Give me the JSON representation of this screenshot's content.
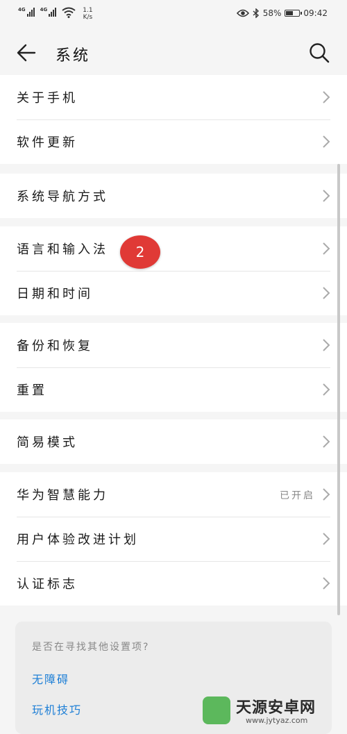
{
  "status_bar": {
    "network_1": "4G",
    "network_2": "4G",
    "speed_value": "1.1",
    "speed_unit": "K/s",
    "battery": "58%",
    "battery_level": 0.58,
    "time": "09:42"
  },
  "header": {
    "title": "系统"
  },
  "groups": [
    {
      "items": [
        {
          "label": "关于手机"
        },
        {
          "label": "软件更新"
        }
      ]
    },
    {
      "items": [
        {
          "label": "系统导航方式"
        }
      ]
    },
    {
      "items": [
        {
          "label": "语言和输入法"
        },
        {
          "label": "日期和时间"
        }
      ]
    },
    {
      "items": [
        {
          "label": "备份和恢复"
        },
        {
          "label": "重置"
        }
      ]
    },
    {
      "items": [
        {
          "label": "简易模式"
        }
      ]
    },
    {
      "items": [
        {
          "label": "华为智慧能力",
          "value": "已开启"
        },
        {
          "label": "用户体验改进计划"
        },
        {
          "label": "认证标志"
        }
      ]
    }
  ],
  "badge": "2",
  "suggest": {
    "question": "是否在寻找其他设置项?",
    "links": [
      "无障碍",
      "玩机技巧"
    ]
  },
  "watermark": {
    "name": "天源安卓网",
    "url": "www.jytyaz.com"
  }
}
